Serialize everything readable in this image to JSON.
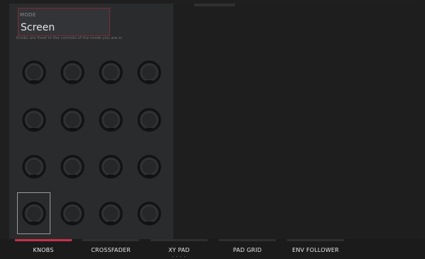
{
  "mode": {
    "label": "MODE",
    "value": "Screen"
  },
  "hint": "Knobs are fixed to the controls of the mode you are in",
  "knobs": {
    "rows": 4,
    "cols": 4,
    "selected_index": 12
  },
  "tabs": [
    {
      "label": "KNOBS",
      "active": true
    },
    {
      "label": "CROSSFADER",
      "active": false
    },
    {
      "label": "XY PAD",
      "active": false,
      "dots": "• • • •"
    },
    {
      "label": "PAD GRID",
      "active": false
    },
    {
      "label": "ENV FOLLOWER",
      "active": false
    }
  ],
  "colors": {
    "accent": "#c9304a",
    "knob_ring": "#111213",
    "panel": "#2a2b2d"
  }
}
